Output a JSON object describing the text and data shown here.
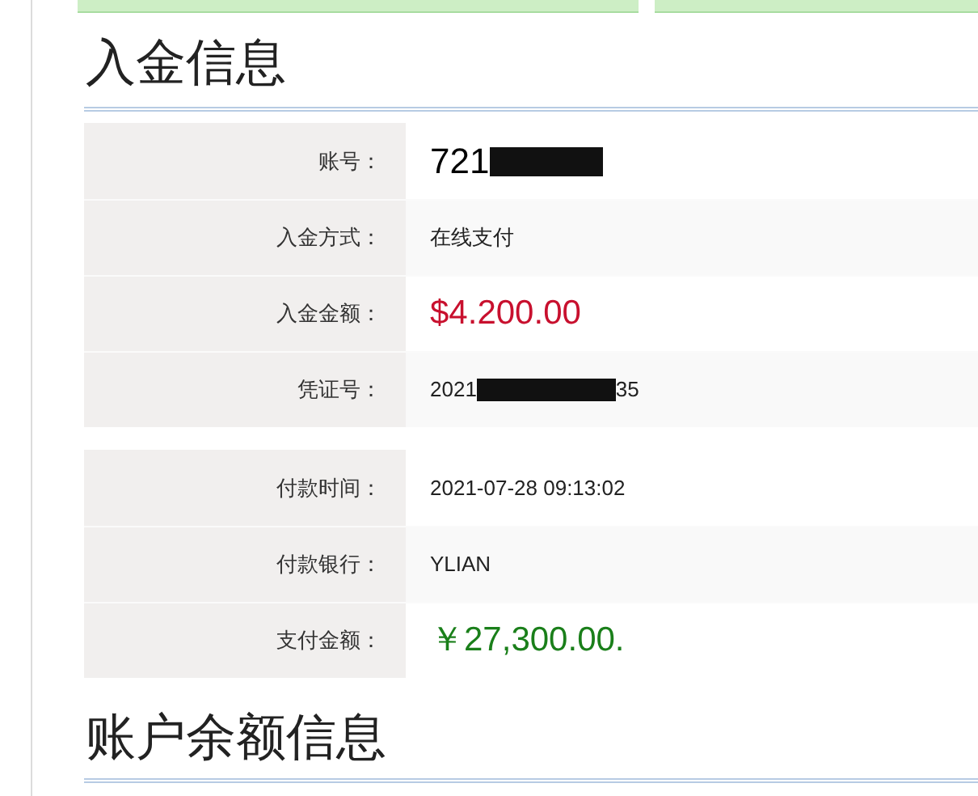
{
  "sections": [
    {
      "title": "入金信息",
      "groups": [
        [
          {
            "label": "账号：",
            "kind": "large",
            "parts": [
              {
                "kind": "text",
                "text": "721"
              },
              {
                "kind": "redaction"
              }
            ]
          },
          {
            "label": "入金方式：",
            "kind": "plain",
            "parts": [
              {
                "kind": "text",
                "text": "在线支付"
              }
            ]
          },
          {
            "label": "入金金额：",
            "kind": "red",
            "parts": [
              {
                "kind": "text",
                "text": "$4.200.00"
              }
            ]
          },
          {
            "label": "凭证号：",
            "kind": "plain",
            "parts": [
              {
                "kind": "text",
                "text": "2021"
              },
              {
                "kind": "redaction"
              },
              {
                "kind": "text",
                "text": "35"
              }
            ]
          }
        ],
        [
          {
            "label": "付款时间：",
            "kind": "plain",
            "parts": [
              {
                "kind": "text",
                "text": "2021-07-28 09:13:02"
              }
            ]
          },
          {
            "label": "付款银行：",
            "kind": "plain",
            "parts": [
              {
                "kind": "text",
                "text": "YLIAN"
              }
            ]
          },
          {
            "label": "支付金额：",
            "kind": "green",
            "parts": [
              {
                "kind": "text",
                "text": "￥27,300.00."
              }
            ]
          }
        ]
      ]
    },
    {
      "title": "账户余额信息"
    }
  ]
}
